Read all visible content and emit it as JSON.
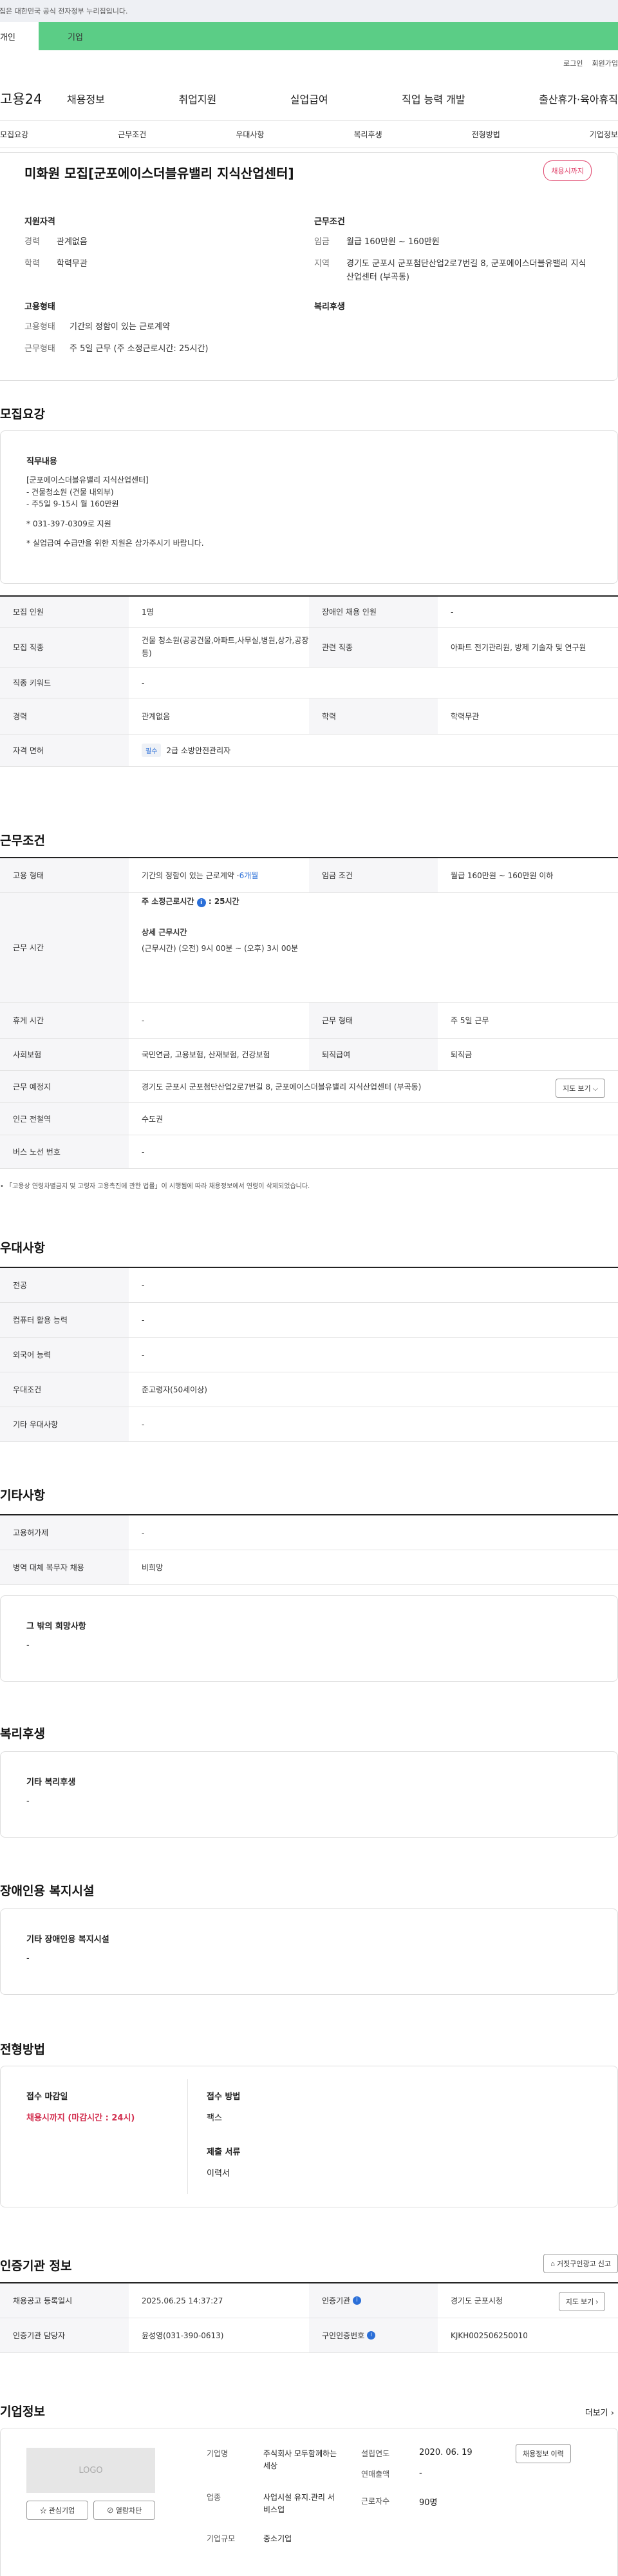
{
  "gov_banner": "이 누리집은 대한민국 공식 전자정부 누리집입니다.",
  "top_tabs": {
    "personal": "개인",
    "company": "기업"
  },
  "util_links": [
    "로그인",
    "회원가입"
  ],
  "logo": "고용24",
  "gnb": [
    "채용정보",
    "취업지원",
    "실업급여",
    "직업 능력 개발",
    "출산휴가·육아휴직"
  ],
  "tabs": [
    "모집요강",
    "근무조건",
    "우대사항",
    "복리후생",
    "전형방법",
    "기업정보"
  ],
  "header": {
    "title": "미화원 모집[군포에이스더블유밸리 지식산업센터]",
    "badge": "채용시까지",
    "qual_title": "지원자격",
    "career_k": "경력",
    "career_v": "관계없음",
    "edu_k": "학력",
    "edu_v": "학력무관",
    "cond_title": "근무조건",
    "wage_k": "임금",
    "wage_v": "월급 160만원 ~ 160만원",
    "region_k": "지역",
    "region_v": "경기도 군포시 군포첨단산업2로7번길 8, 군포에이스더블유밸리 지식산업센터 (부곡동)",
    "emp_title": "고용형태",
    "emptype_k": "고용형태",
    "emptype_v": "기간의 정함이 있는 근로계약",
    "workform_k": "근무형태",
    "workform_v": "주 5일 근무 (주 소정근로시간: 25시간)",
    "welfare_title": "복리후생"
  },
  "recruit": {
    "section": "모집요강",
    "duty_title": "직무내용",
    "duty_lines": [
      "[군포에이스더블유밸리 지식산업센터]",
      "- 건물청소원 (건물 내외부)",
      "- 주5일 9-15시 월 160만원",
      "",
      "* 031-397-0309로 지원",
      "",
      "* 실업급여 수급만을 위한 지원은 삼가주시기 바랍니다."
    ],
    "rows": [
      {
        "k1": "모집 인원",
        "v1": "1명",
        "k2": "장애인 채용 인원",
        "v2": "-"
      },
      {
        "k1": "모집 직종",
        "v1": "건물 청소원(공공건물,아파트,사무실,병원,상가,공장 등)",
        "k2": "관련 직종",
        "v2": "아파트 전기관리원, 방제 기술자 및 연구원"
      },
      {
        "k1": "직종 키워드",
        "v1": "-"
      },
      {
        "k1": "경력",
        "v1": "관계없음",
        "k2": "학력",
        "v2": "학력무관"
      },
      {
        "k1": "자격 면허",
        "badge": "필수",
        "v1": "2급 소방안전관리자"
      }
    ]
  },
  "cond": {
    "section": "근무조건",
    "emp_k": "고용 형태",
    "emp_v": "기간의 정함이 있는 근로계약 · ",
    "emp_period": "6개월",
    "wage_k": "임금 조건",
    "wage_v": "월급 160만원 ~ 160만원 이하",
    "time_k": "근무 시간",
    "time_title": "주 소정근로시간",
    "time_hours": ": 25시간",
    "detail_title": "상세 근무시간",
    "detail_v": "(근무시간) (오전) 9시 00분 ~ (오후) 3시 00분",
    "rest_k": "휴게 시간",
    "rest_v": "-",
    "form_k": "근무 형태",
    "form_v": "주 5일 근무",
    "ins_k": "사회보험",
    "ins_v": "국민연금, 고용보험, 산재보험, 건강보험",
    "ret_k": "퇴직급여",
    "ret_v": "퇴직금",
    "place_k": "근무 예정지",
    "place_v": "경기도 군포시 군포첨단산업2로7번길 8, 군포에이스더블유밸리 지식산업센터 (부곡동)",
    "map_btn": "지도 보기",
    "subway_k": "인근 전철역",
    "subway_v": "수도권",
    "bus_k": "버스 노선 번호",
    "bus_v": "-",
    "note": "「고용상 연령차별금지 및 고령자 고용촉진에 관한 법률」이 시행됨에 따라 채용정보에서 연령이 삭제되었습니다."
  },
  "pref": {
    "section": "우대사항",
    "rows": [
      {
        "k": "전공",
        "v": "-"
      },
      {
        "k": "컴퓨터 활용 능력",
        "v": "-"
      },
      {
        "k": "외국어 능력",
        "v": "-"
      },
      {
        "k": "우대조건",
        "v": "준고령자(50세이상)"
      },
      {
        "k": "기타 우대사항",
        "v": "-"
      }
    ]
  },
  "etc": {
    "section": "기타사항",
    "rows": [
      {
        "k": "고용허가제",
        "v": "-"
      },
      {
        "k": "병역 대체 복무자 채용",
        "v": "비희망"
      }
    ],
    "hope_title": "그 밖의 희망사항",
    "hope_v": "-"
  },
  "welfare": {
    "section": "복리후생",
    "title": "기타 복리후생",
    "v": "-"
  },
  "disabled": {
    "section": "장애인용 복지시설",
    "title": "기타 장애인용 복지시설",
    "v": "-"
  },
  "selection": {
    "section": "전형방법",
    "deadline_t": "접수 마감일",
    "deadline_v": "채용시까지 (마감시간 : 24시)",
    "method_t": "접수 방법",
    "method_v": "팩스",
    "docs_t": "제출 서류",
    "docs_v": "이력서"
  },
  "agency": {
    "section": "인증기관 정보",
    "report_btn": "거짓구인광고 신고",
    "reg_k": "채용공고 등록일시",
    "reg_v": "2025.06.25 14:37:27",
    "agency_k": "인증기관",
    "agency_v": "경기도 군포시청",
    "map_btn": "지도 보기",
    "mgr_k": "인증기관 담당자",
    "mgr_v": "윤성영(031-390-0613)",
    "no_k": "구인인증번호",
    "no_v": "KJKH002506250010"
  },
  "company": {
    "section": "기업정보",
    "more": "더보기",
    "logo": "LOGO",
    "interest_btn": "관심기업",
    "block_btn": "열람차단",
    "name_k": "기업명",
    "name_v": "주식회사 모두함께하는세상",
    "est_k": "설립연도",
    "est_v": "2020. 06. 19",
    "info_btn": "채용정보 이력",
    "sales_k": "연매출액",
    "sales_v": "-",
    "ind_k": "업종",
    "ind_v": "사업시설 유지.관리 서비스업",
    "emp_k": "근로자수",
    "emp_v": "90명",
    "size_k": "기업규모",
    "size_v": "중소기업"
  }
}
